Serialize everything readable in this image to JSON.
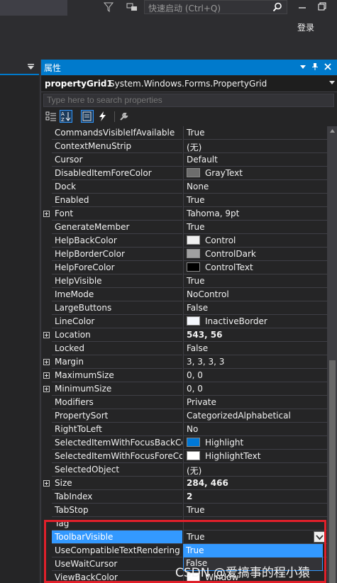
{
  "topbar": {
    "quick_launch_placeholder": "快速启动 (Ctrl+Q)",
    "login_label": "登录",
    "icons": [
      "funnel-icon",
      "feedback-icon",
      "search-icon",
      "minimize-icon",
      "restore-icon"
    ]
  },
  "panel": {
    "title": "属性",
    "object_name": "propertyGrid1",
    "object_type": "System.Windows.Forms.PropertyGrid",
    "search_placeholder": "Type here to search properties",
    "accent": "#007acc",
    "selection": "#3399ff"
  },
  "properties": [
    {
      "name": "CommandsVisibleIfAvailable",
      "value": "True"
    },
    {
      "name": "ContextMenuStrip",
      "value": "(无)"
    },
    {
      "name": "Cursor",
      "value": "Default"
    },
    {
      "name": "DisabledItemForeColor",
      "value": "GrayText",
      "color": "#6d6d6d"
    },
    {
      "name": "Dock",
      "value": "None"
    },
    {
      "name": "Enabled",
      "value": "True"
    },
    {
      "name": "Font",
      "value": "Tahoma, 9pt",
      "expandable": true
    },
    {
      "name": "GenerateMember",
      "value": "True"
    },
    {
      "name": "HelpBackColor",
      "value": "Control",
      "color": "#f0f0f0"
    },
    {
      "name": "HelpBorderColor",
      "value": "ControlDark",
      "color": "#a0a0a0"
    },
    {
      "name": "HelpForeColor",
      "value": "ControlText",
      "color": "#000000"
    },
    {
      "name": "HelpVisible",
      "value": "True"
    },
    {
      "name": "ImeMode",
      "value": "NoControl"
    },
    {
      "name": "LargeButtons",
      "value": "False"
    },
    {
      "name": "LineColor",
      "value": "InactiveBorder",
      "color": "#f4f7fc"
    },
    {
      "name": "Location",
      "value": "543, 56",
      "expandable": true,
      "bold": true
    },
    {
      "name": "Locked",
      "value": "False"
    },
    {
      "name": "Margin",
      "value": "3, 3, 3, 3",
      "expandable": true
    },
    {
      "name": "MaximumSize",
      "value": "0, 0",
      "expandable": true
    },
    {
      "name": "MinimumSize",
      "value": "0, 0",
      "expandable": true
    },
    {
      "name": "Modifiers",
      "value": "Private"
    },
    {
      "name": "PropertySort",
      "value": "CategorizedAlphabetical"
    },
    {
      "name": "RightToLeft",
      "value": "No"
    },
    {
      "name": "SelectedItemWithFocusBackColor",
      "value": "Highlight",
      "color": "#0078d7"
    },
    {
      "name": "SelectedItemWithFocusForeColor",
      "value": "HighlightText",
      "color": "#ffffff"
    },
    {
      "name": "SelectedObject",
      "value": "(无)"
    },
    {
      "name": "Size",
      "value": "284, 466",
      "expandable": true,
      "bold": true
    },
    {
      "name": "TabIndex",
      "value": "2",
      "bold": true
    },
    {
      "name": "TabStop",
      "value": "True"
    },
    {
      "name": "Tag",
      "value": ""
    },
    {
      "name": "ToolbarVisible",
      "value": "True",
      "selected": true
    },
    {
      "name": "UseCompatibleTextRendering",
      "value": "False"
    },
    {
      "name": "UseWaitCursor",
      "value": "False"
    },
    {
      "name": "ViewBackColor",
      "value": "Window",
      "color": "#ffffff"
    }
  ],
  "dropdown": {
    "options": [
      "True",
      "False"
    ],
    "highlighted": "True"
  },
  "watermark": "CSDN @爱搞事的程小猿"
}
